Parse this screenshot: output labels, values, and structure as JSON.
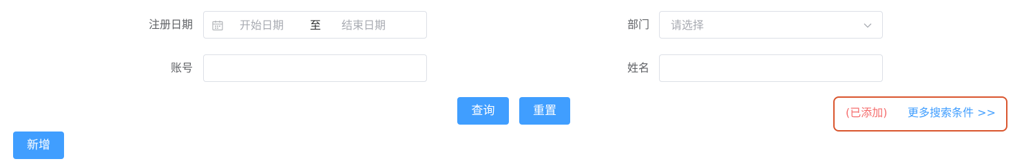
{
  "filters": {
    "register_date": {
      "label": "注册日期",
      "start_placeholder": "开始日期",
      "separator": "至",
      "end_placeholder": "结束日期"
    },
    "department": {
      "label": "部门",
      "placeholder": "请选择"
    },
    "account": {
      "label": "账号",
      "value": ""
    },
    "name": {
      "label": "姓名",
      "value": ""
    }
  },
  "actions": {
    "query_label": "查询",
    "reset_label": "重置",
    "add_label": "新增"
  },
  "more_search": {
    "added_text": "(已添加)",
    "link_text": "更多搜索条件 >>"
  },
  "colors": {
    "primary": "#409eff",
    "highlight_border": "#d9542c",
    "added_text": "#f56c6c"
  }
}
